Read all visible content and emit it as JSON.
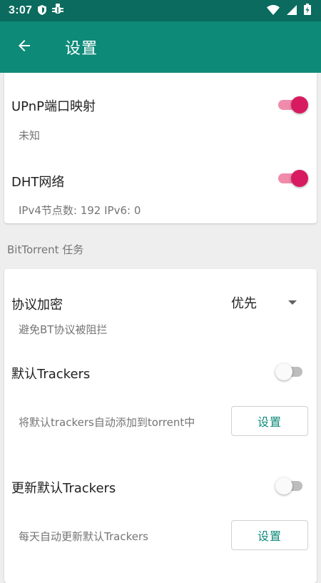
{
  "status_bar": {
    "time": "3:07",
    "icons": [
      "shield-icon",
      "bug-icon",
      "wifi-icon",
      "cell-signal-icon",
      "battery-charging-icon"
    ]
  },
  "app_bar": {
    "title": "设置",
    "back_icon": "arrow-left-icon"
  },
  "network_section": {
    "items": [
      {
        "title": "UPnP端口映射",
        "summary": "未知",
        "checked": true
      },
      {
        "title": "DHT网络",
        "summary": "IPv4节点数: 192 IPv6:  0",
        "checked": true
      }
    ]
  },
  "bittorrent_section": {
    "header": "BitTorrent 任务",
    "encryption": {
      "title": "协议加密",
      "summary": "避免BT协议被阻拦",
      "selected": "优先"
    },
    "default_trackers": {
      "title": "默认Trackers",
      "summary": "将默认trackers自动添加到torrent中",
      "checked": false,
      "button_label": "设置"
    },
    "update_trackers": {
      "title": "更新默认Trackers",
      "summary": "每天自动更新默认Trackers",
      "checked": false,
      "button_label": "设置"
    }
  },
  "colors": {
    "status_bar": "#0a6b5e",
    "app_bar": "#0e8a79",
    "switch_on_thumb": "#d81b60",
    "switch_on_track": "#f08bab",
    "button_text": "#0e8a79"
  }
}
